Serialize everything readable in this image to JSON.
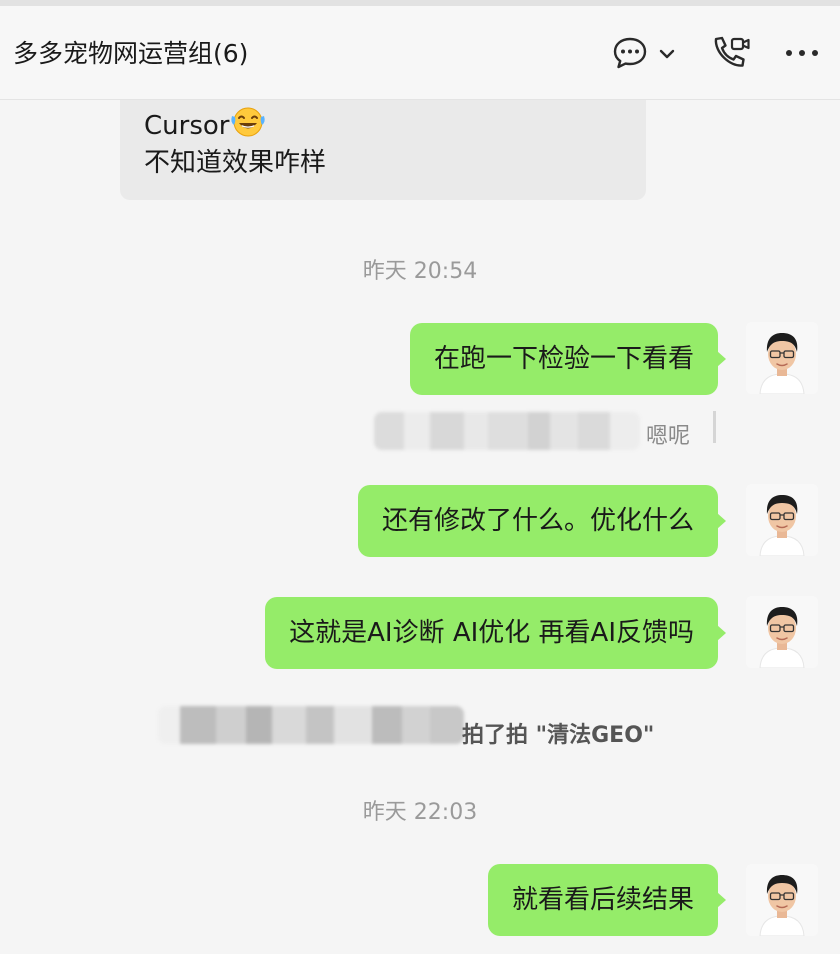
{
  "header": {
    "title": "多多宠物网运营组(6)",
    "icons": [
      "chat-bubble-icon",
      "chevron-down-icon",
      "call-icon",
      "more-icon"
    ]
  },
  "messages": {
    "incoming_1": {
      "line1": "Cursor",
      "emoji": "laughing-tears-emoji",
      "line2": "不知道效果咋样"
    },
    "time_1": "昨天 20:54",
    "out_1": "在跑一下检验一下看看",
    "quote_1": "嗯呢",
    "out_2": "还有修改了什么。优化什么",
    "out_3": "这就是AI诊断 AI优化 再看AI反馈吗",
    "pat_notice": "拍了拍 \"清法GEO\"",
    "time_2": "昨天 22:03",
    "out_4": "就看看后续结果"
  },
  "colors": {
    "outgoing_bubble": "#95ec69",
    "incoming_bubble": "#eaeaea",
    "background": "#f5f5f5",
    "timestamp": "#9a9a9a"
  }
}
